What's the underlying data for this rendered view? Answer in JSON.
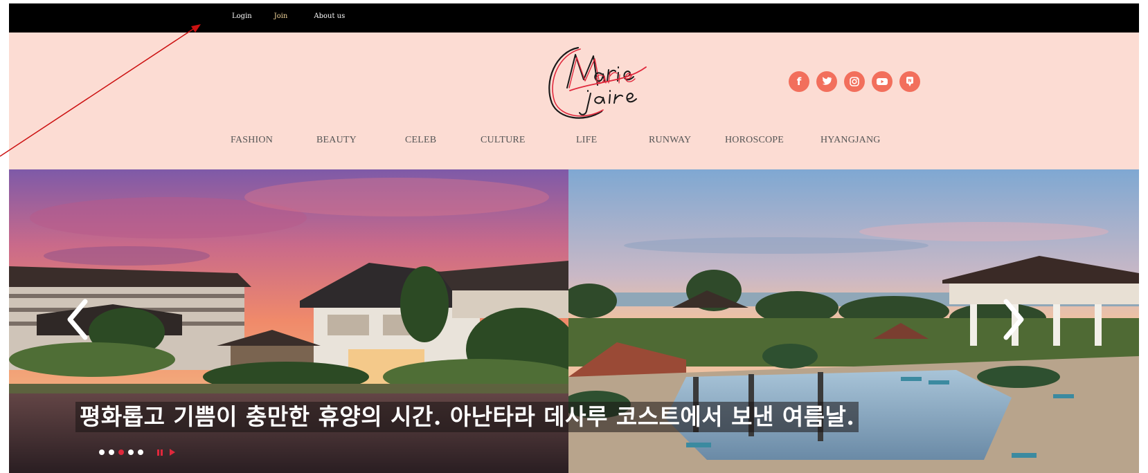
{
  "topbar": {
    "login_label": "Login",
    "join_label": "Join",
    "about_label": "About us"
  },
  "header": {
    "logo_text": "Marie Claire",
    "social_icons": [
      "facebook-icon",
      "twitter-icon",
      "instagram-icon",
      "youtube-icon",
      "post-icon"
    ],
    "nav": [
      "FASHION",
      "BEAUTY",
      "CELEB",
      "CULTURE",
      "LIFE",
      "RUNWAY",
      "HOROSCOPE",
      "HYANGJANG"
    ]
  },
  "hero": {
    "caption": "평화롭고 기쁨이 충만한 휴양의 시간. 아난타라 데사루 코스트에서 보낸 여름날.",
    "slides_total": 5,
    "active_slide": 3,
    "prev_icon": "chevron-left-icon",
    "next_icon": "chevron-right-icon"
  },
  "colors": {
    "header_bg": "#fcdcd3",
    "social_icon": "#f26f5c",
    "active_dot": "#e0283c",
    "annotation_arrow": "#cc1111"
  }
}
